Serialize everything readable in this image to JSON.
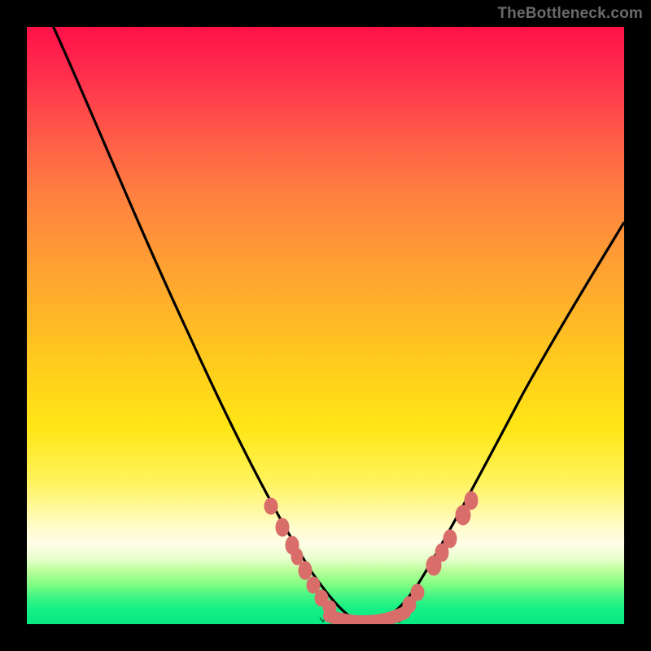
{
  "watermark": "TheBottleneck.com",
  "chart_data": {
    "type": "line",
    "title": "",
    "xlabel": "",
    "ylabel": "",
    "xlim": [
      0,
      100
    ],
    "ylim": [
      0,
      100
    ],
    "description": "Bottleneck-style performance mismatch curve on a red-to-green vertical gradient. No numeric axes shown; values below are pixel-space estimates in a 0–100 coordinate frame.",
    "series": [
      {
        "name": "bottleneck-curve",
        "x": [
          3,
          10,
          18,
          26,
          32,
          38,
          44,
          48,
          52,
          55,
          58,
          61,
          64,
          68,
          74,
          82,
          90,
          98,
          100
        ],
        "y": [
          100,
          88,
          74,
          60,
          48,
          36,
          22,
          12,
          5,
          1,
          0,
          1,
          3,
          7,
          16,
          30,
          46,
          64,
          68
        ]
      }
    ],
    "highlight_points": {
      "name": "salmon-dots",
      "note": "Scattered salmon-colored marks along the curve near the valley bottom and slopes",
      "x": [
        40,
        42,
        44,
        46,
        48,
        50,
        53,
        55,
        58,
        60,
        62,
        64,
        68,
        71
      ],
      "y": [
        18,
        14,
        11,
        8,
        5,
        2,
        0,
        0,
        1,
        3,
        6,
        9,
        15,
        20
      ]
    }
  }
}
